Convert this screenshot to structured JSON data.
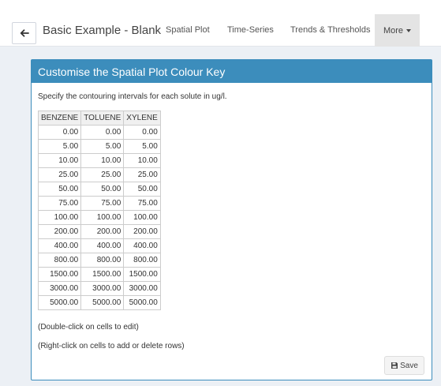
{
  "header": {
    "title": "Basic Example - Blank",
    "nav": [
      {
        "label": "Spatial Plot"
      },
      {
        "label": "Time-Series"
      },
      {
        "label": "Trends & Thresholds"
      }
    ],
    "more_label": "More"
  },
  "panel": {
    "title": "Customise the Spatial Plot Colour Key",
    "description": "Specify the contouring intervals for each solute in ug/l.",
    "columns": [
      "BENZENE",
      "TOLUENE",
      "XYLENE"
    ],
    "rows": [
      [
        "0.00",
        "0.00",
        "0.00"
      ],
      [
        "5.00",
        "5.00",
        "5.00"
      ],
      [
        "10.00",
        "10.00",
        "10.00"
      ],
      [
        "25.00",
        "25.00",
        "25.00"
      ],
      [
        "50.00",
        "50.00",
        "50.00"
      ],
      [
        "75.00",
        "75.00",
        "75.00"
      ],
      [
        "100.00",
        "100.00",
        "100.00"
      ],
      [
        "200.00",
        "200.00",
        "200.00"
      ],
      [
        "400.00",
        "400.00",
        "400.00"
      ],
      [
        "800.00",
        "800.00",
        "800.00"
      ],
      [
        "1500.00",
        "1500.00",
        "1500.00"
      ],
      [
        "3000.00",
        "3000.00",
        "3000.00"
      ],
      [
        "5000.00",
        "5000.00",
        "5000.00"
      ]
    ],
    "hint_edit": "(Double-click on cells to edit)",
    "hint_rows": "(Right-click on cells to add or delete rows)",
    "save_label": "Save"
  },
  "icons": {
    "back": "arrow-left-icon",
    "save": "floppy-disk-icon",
    "more": "caret-down-icon"
  },
  "colors": {
    "panel_header": "#3c8dbc",
    "background": "#ecf0f5",
    "more_tab_active": "#e4e4e4"
  }
}
